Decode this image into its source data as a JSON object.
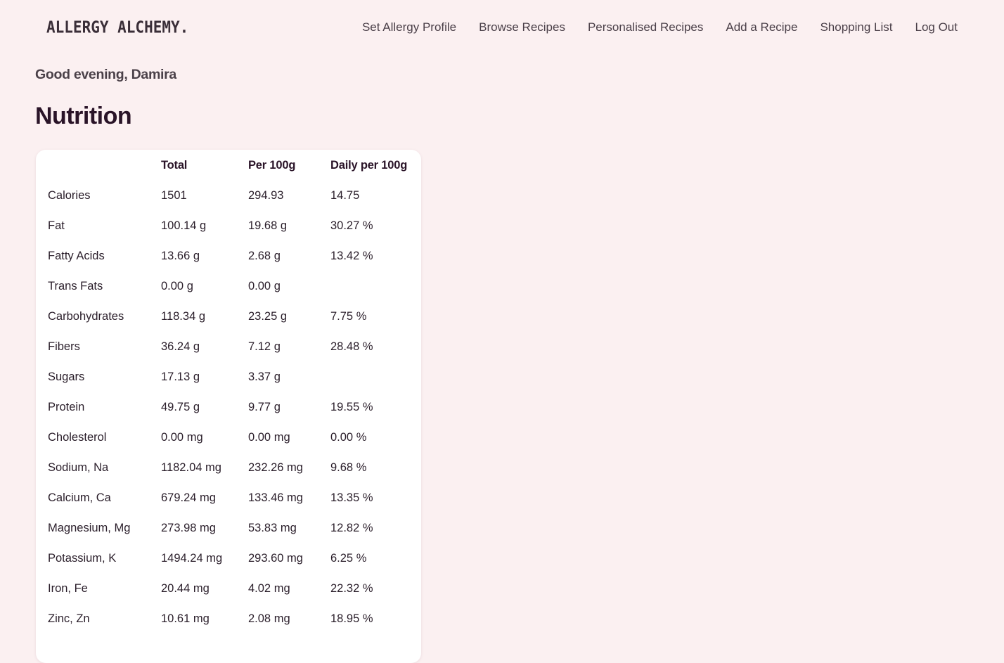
{
  "header": {
    "logo": "ALLERGY ALCHEMY.",
    "nav": [
      {
        "label": "Set Allergy Profile"
      },
      {
        "label": "Browse Recipes"
      },
      {
        "label": "Personalised Recipes"
      },
      {
        "label": "Add a Recipe"
      },
      {
        "label": "Shopping List"
      },
      {
        "label": "Log Out"
      }
    ]
  },
  "main": {
    "greeting": "Good evening, Damira",
    "title": "Nutrition",
    "table": {
      "columns": [
        "",
        "Total",
        "Per 100g",
        "Daily per 100g"
      ],
      "rows": [
        [
          "Calories",
          "1501",
          "294.93",
          "14.75"
        ],
        [
          "Fat",
          "100.14 g",
          "19.68 g",
          "30.27 %"
        ],
        [
          "Fatty Acids",
          "13.66 g",
          "2.68 g",
          "13.42 %"
        ],
        [
          "Trans Fats",
          "0.00 g",
          "0.00 g",
          ""
        ],
        [
          "Carbohydrates",
          "118.34 g",
          "23.25 g",
          "7.75 %"
        ],
        [
          "Fibers",
          "36.24 g",
          "7.12 g",
          "28.48 %"
        ],
        [
          "Sugars",
          "17.13 g",
          "3.37 g",
          ""
        ],
        [
          "Protein",
          "49.75 g",
          "9.77 g",
          "19.55 %"
        ],
        [
          "Cholesterol",
          "0.00 mg",
          "0.00 mg",
          "0.00 %"
        ],
        [
          "Sodium, Na",
          "1182.04 mg",
          "232.26 mg",
          "9.68 %"
        ],
        [
          "Calcium, Ca",
          "679.24 mg",
          "133.46 mg",
          "13.35 %"
        ],
        [
          "Magnesium, Mg",
          "273.98 mg",
          "53.83 mg",
          "12.82 %"
        ],
        [
          "Potassium, K",
          "1494.24 mg",
          "293.60 mg",
          "6.25 %"
        ],
        [
          "Iron, Fe",
          "20.44 mg",
          "4.02 mg",
          "22.32 %"
        ],
        [
          "Zinc, Zn",
          "10.61 mg",
          "2.08 mg",
          "18.95 %"
        ]
      ]
    }
  },
  "colors": {
    "background": "#fbf0f1",
    "card": "#ffffff",
    "text": "#2a1a2a",
    "nav_text": "#4a3f48"
  }
}
